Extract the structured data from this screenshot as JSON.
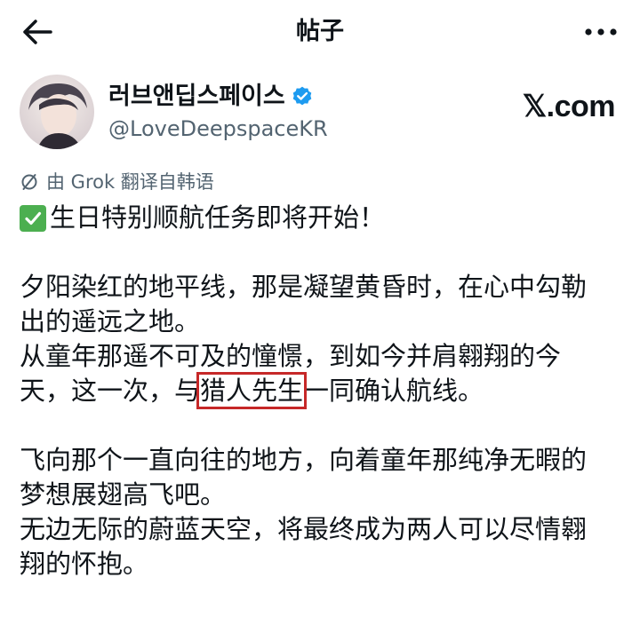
{
  "header": {
    "title": "帖子"
  },
  "author": {
    "display_name": "러브앤딥스페이스",
    "handle": "@LoveDeepspaceKR"
  },
  "source_watermark": "𝕏.com",
  "translation_note": "由 Grok 翻译自韩语",
  "post": {
    "headline": "生日特别顺航任务即将开始！",
    "para1_line1": "夕阳染红的地平线，那是凝望黄昏时，在心中勾勒",
    "para1_line2": "出的遥远之地。",
    "para2_line1": "从童年那遥不可及的憧憬，到如今并肩翱翔的今",
    "para2_line2_before": "天，这一次，与",
    "para2_highlight": "猎人先生",
    "para2_line2_after": "一同确认航线。",
    "para3_line1": "飞向那个一直向往的地方，向着童年那纯净无暇的",
    "para3_line2": "梦想展翅高飞吧。",
    "para4_line1": "无边无际的蔚蓝天空，将最终成为两人可以尽情翱",
    "para4_line2": "翔的怀抱。"
  },
  "colors": {
    "text": "#0f1419",
    "muted": "#536471",
    "verified": "#1d9bf0",
    "highlight_border": "#c62828",
    "check": "#4caf50"
  },
  "icons": {
    "back": "arrow-left-icon",
    "more": "more-horizontal-icon",
    "verified": "verified-badge-icon",
    "translate": "translate-icon",
    "check": "check-mark-button-icon"
  }
}
